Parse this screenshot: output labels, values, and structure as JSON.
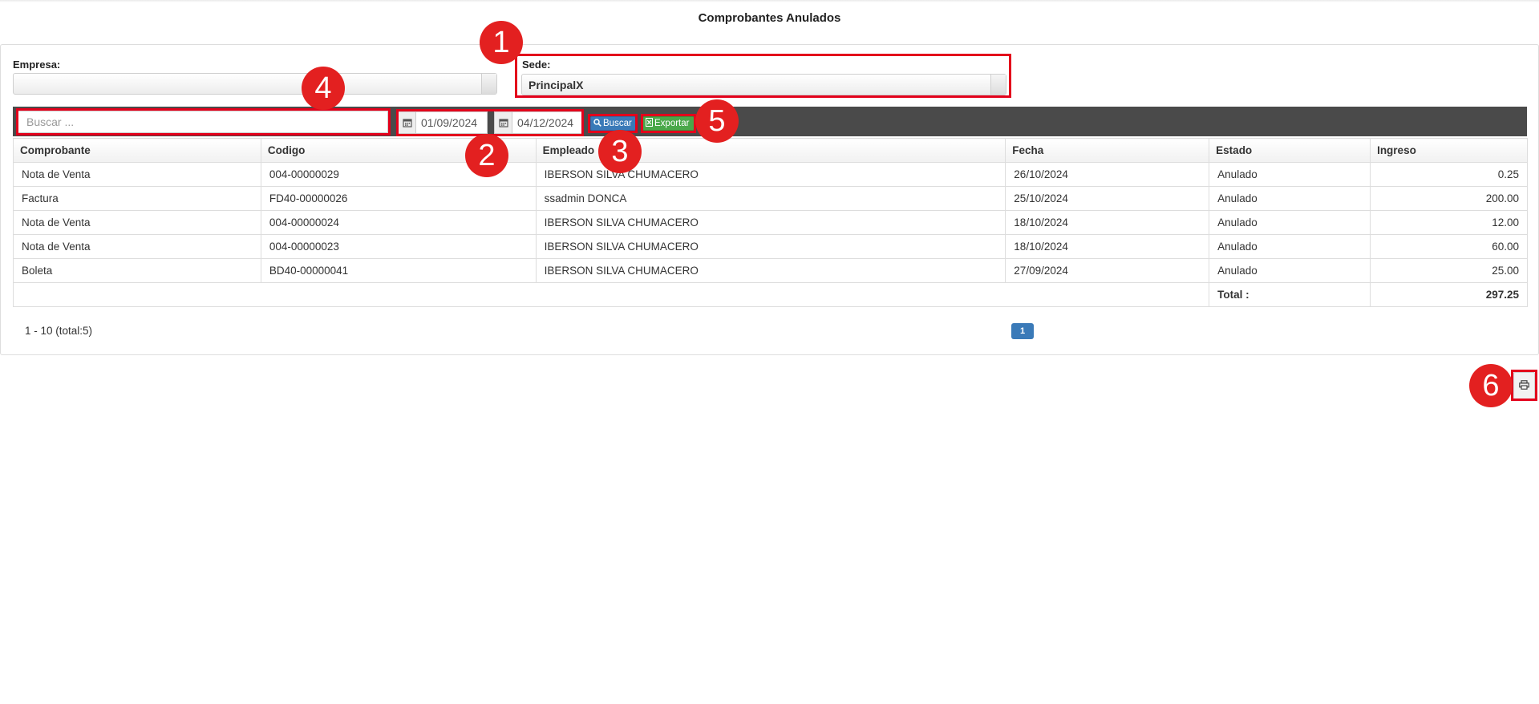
{
  "page": {
    "title": "Comprobantes Anulados"
  },
  "filters": {
    "empresa_label": "Empresa:",
    "empresa_value": "",
    "sede_label": "Sede:",
    "sede_value": "PrincipalX"
  },
  "toolbar": {
    "search_placeholder": "Buscar ...",
    "date_from": "01/09/2024",
    "date_to": "04/12/2024",
    "buscar_label": "Buscar",
    "exportar_label": "Exportar"
  },
  "table": {
    "headers": [
      "Comprobante",
      "Codigo",
      "Empleado",
      "Fecha",
      "Estado",
      "Ingreso"
    ],
    "rows": [
      [
        "Nota de Venta",
        "004-00000029",
        "IBERSON SILVA CHUMACERO",
        "26/10/2024",
        "Anulado",
        "0.25"
      ],
      [
        "Factura",
        "FD40-00000026",
        "ssadmin DONCA",
        "25/10/2024",
        "Anulado",
        "200.00"
      ],
      [
        "Nota de Venta",
        "004-00000024",
        "IBERSON SILVA CHUMACERO",
        "18/10/2024",
        "Anulado",
        "12.00"
      ],
      [
        "Nota de Venta",
        "004-00000023",
        "IBERSON SILVA CHUMACERO",
        "18/10/2024",
        "Anulado",
        "60.00"
      ],
      [
        "Boleta",
        "BD40-00000041",
        "IBERSON SILVA CHUMACERO",
        "27/09/2024",
        "Anulado",
        "25.00"
      ]
    ],
    "total_label": "Total :",
    "total_value": "297.25"
  },
  "pagination": {
    "info": "1 - 10 (total:5)",
    "current_page": "1"
  },
  "annotations": [
    "1",
    "2",
    "3",
    "4",
    "5",
    "6"
  ],
  "icons": {
    "calendar": "calendar-icon",
    "search": "search-icon",
    "excel": "excel-icon",
    "print": "print-icon"
  },
  "colors": {
    "toolbar": "#4a4a4a",
    "primary": "#3a7ab8",
    "success": "#4aa84a",
    "annotation": "#e32020"
  }
}
